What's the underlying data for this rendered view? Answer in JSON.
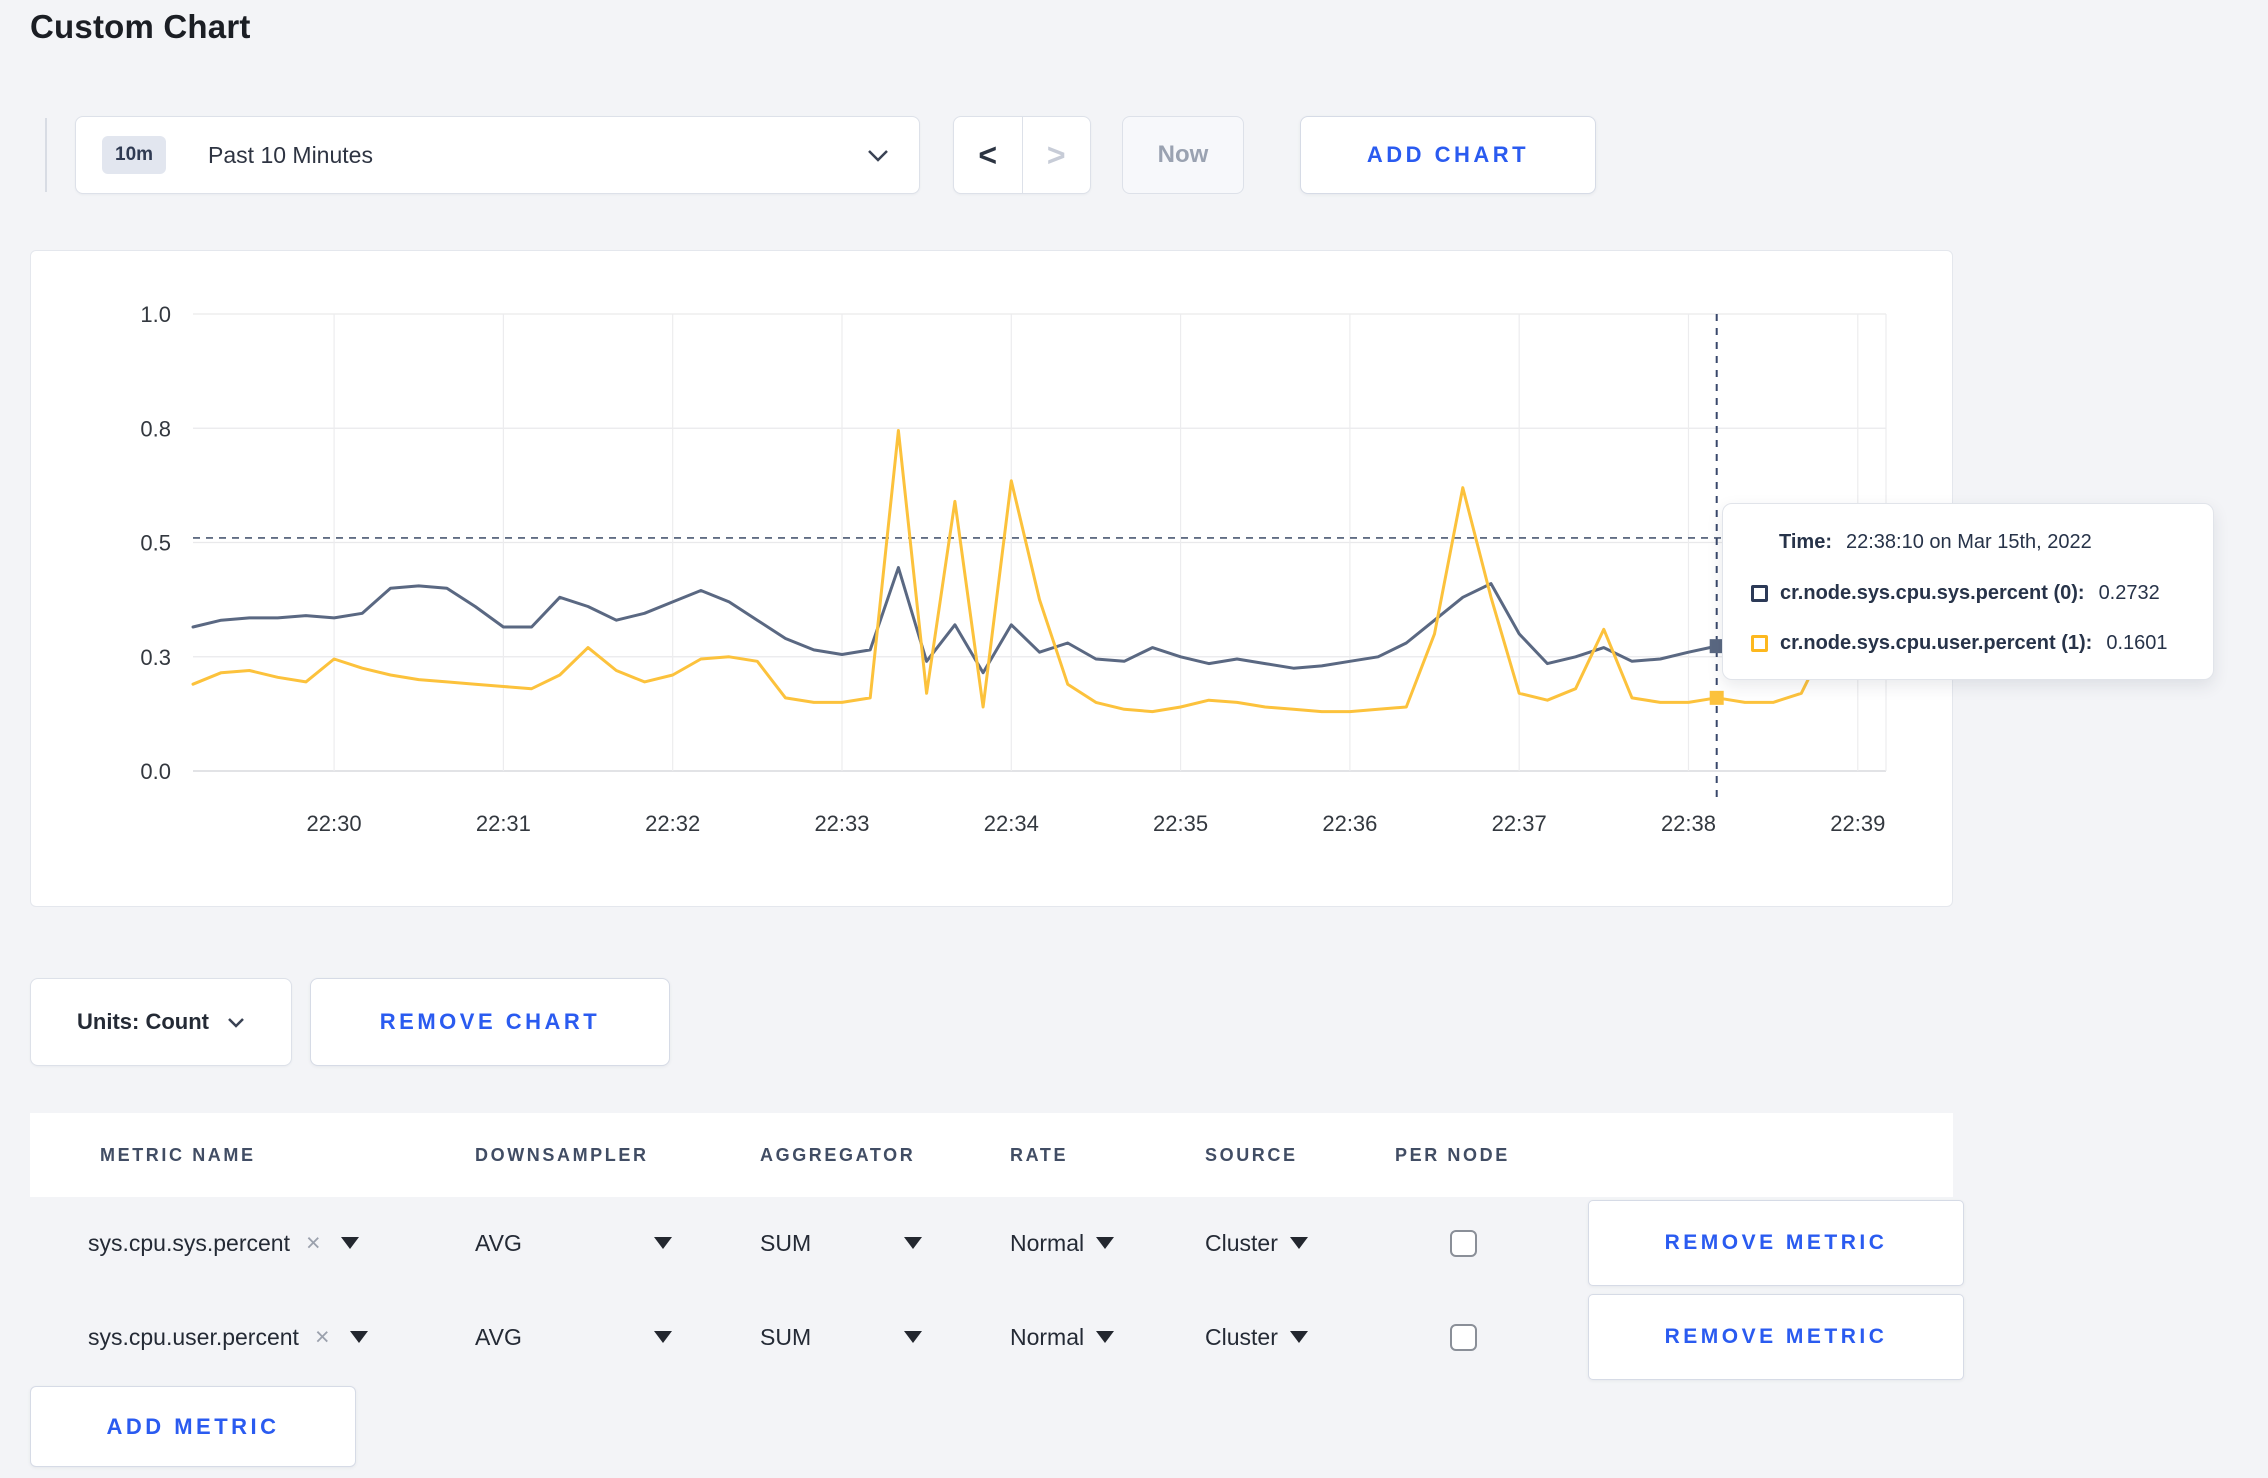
{
  "page": {
    "title": "Custom Chart"
  },
  "toolbar": {
    "time_badge": "10m",
    "time_label": "Past 10 Minutes",
    "prev_label": "<",
    "next_label": ">",
    "now_label": "Now",
    "add_chart_label": "ADD CHART"
  },
  "chart_actions": {
    "units_label": "Units: Count",
    "remove_chart_label": "REMOVE CHART"
  },
  "tooltip": {
    "time_label": "Time:",
    "time_value": "22:38:10 on Mar 15th, 2022",
    "series": [
      {
        "label": "cr.node.sys.cpu.sys.percent (0):",
        "value": "0.2732",
        "color": "#2c3a57"
      },
      {
        "label": "cr.node.sys.cpu.user.percent (1):",
        "value": "0.1601",
        "color": "#fdb81e"
      }
    ]
  },
  "metrics_table": {
    "headers": [
      "METRIC NAME",
      "DOWNSAMPLER",
      "AGGREGATOR",
      "RATE",
      "SOURCE",
      "PER NODE"
    ],
    "close_symbol": "×",
    "rows": [
      {
        "metric": "sys.cpu.sys.percent",
        "downsampler": "AVG",
        "aggregator": "SUM",
        "rate": "Normal",
        "source": "Cluster",
        "per_node_checked": false,
        "remove_label": "REMOVE METRIC"
      },
      {
        "metric": "sys.cpu.user.percent",
        "downsampler": "AVG",
        "aggregator": "SUM",
        "rate": "Normal",
        "source": "Cluster",
        "per_node_checked": false,
        "remove_label": "REMOVE METRIC"
      }
    ],
    "add_metric_label": "ADD METRIC"
  },
  "colors": {
    "accent_blue": "#2a5bf0",
    "page_bg": "#f3f4f7",
    "grid": "#ececee",
    "axis_line": "#d9dadd",
    "crosshair": "#39486b"
  },
  "chart_data": {
    "type": "line",
    "title": "",
    "xlabel": "",
    "ylabel": "",
    "ylim": [
      0,
      1
    ],
    "grid": true,
    "legend_position": "none",
    "x_reference": "seconds after 22:29:00 on Mar 15th, 2022",
    "domain_seconds": [
      10,
      610
    ],
    "x_start_seconds": 10,
    "x_step_seconds": 10,
    "x_ticks": [
      {
        "t": 60,
        "label": "22:30"
      },
      {
        "t": 120,
        "label": "22:31"
      },
      {
        "t": 180,
        "label": "22:32"
      },
      {
        "t": 240,
        "label": "22:33"
      },
      {
        "t": 300,
        "label": "22:34"
      },
      {
        "t": 360,
        "label": "22:35"
      },
      {
        "t": 420,
        "label": "22:36"
      },
      {
        "t": 480,
        "label": "22:37"
      },
      {
        "t": 540,
        "label": "22:38"
      },
      {
        "t": 600,
        "label": "22:39"
      }
    ],
    "y_ticks": [
      {
        "value": 0,
        "label": "0.0"
      },
      {
        "value": 0.25,
        "label": "0.3"
      },
      {
        "value": 0.5,
        "label": "0.5"
      },
      {
        "value": 0.75,
        "label": "0.8"
      },
      {
        "value": 1,
        "label": "1.0"
      }
    ],
    "guideline_y": 0.51,
    "crosshair": {
      "t_seconds": 550,
      "time": "22:38:10",
      "values": [
        0.2732,
        0.1601
      ]
    },
    "series": [
      {
        "name": "cr.node.sys.cpu.sys.percent",
        "color": "#5a6882",
        "values": [
          0.315,
          0.33,
          0.335,
          0.335,
          0.34,
          0.335,
          0.345,
          0.4,
          0.405,
          0.4,
          0.36,
          0.315,
          0.315,
          0.38,
          0.36,
          0.33,
          0.345,
          0.37,
          0.395,
          0.37,
          0.33,
          0.29,
          0.265,
          0.255,
          0.265,
          0.445,
          0.24,
          0.32,
          0.215,
          0.32,
          0.26,
          0.28,
          0.245,
          0.24,
          0.27,
          0.25,
          0.235,
          0.245,
          0.235,
          0.225,
          0.23,
          0.24,
          0.25,
          0.28,
          0.33,
          0.38,
          0.41,
          0.3,
          0.235,
          0.25,
          0.27,
          0.24,
          0.245,
          0.26,
          0.2732,
          0.28,
          0.29,
          0.285,
          0.28,
          0.27,
          0.3
        ]
      },
      {
        "name": "cr.node.sys.cpu.user.percent",
        "color": "#fcc23c",
        "values": [
          0.19,
          0.215,
          0.22,
          0.205,
          0.195,
          0.245,
          0.225,
          0.21,
          0.2,
          0.195,
          0.19,
          0.185,
          0.18,
          0.21,
          0.27,
          0.22,
          0.195,
          0.21,
          0.245,
          0.25,
          0.24,
          0.16,
          0.15,
          0.15,
          0.16,
          0.745,
          0.17,
          0.59,
          0.14,
          0.635,
          0.375,
          0.19,
          0.15,
          0.135,
          0.13,
          0.14,
          0.155,
          0.15,
          0.14,
          0.135,
          0.13,
          0.13,
          0.135,
          0.14,
          0.3,
          0.62,
          0.38,
          0.17,
          0.155,
          0.18,
          0.31,
          0.16,
          0.15,
          0.15,
          0.1601,
          0.15,
          0.15,
          0.17,
          0.295,
          0.22,
          0.27
        ]
      }
    ]
  }
}
